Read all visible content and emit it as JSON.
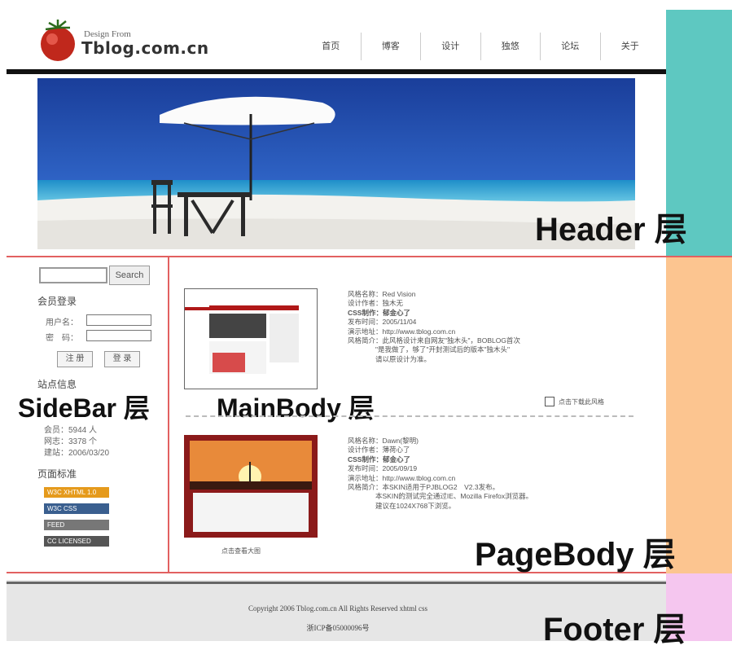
{
  "colors": {
    "header_strip": "#5ec8c1",
    "pagebody_strip": "#fcc590",
    "footer_strip": "#f5c6ef",
    "divider": "#e26060"
  },
  "logo": {
    "small_text": "Design From",
    "name": "Tblog.com.cn"
  },
  "nav": [
    "首页",
    "博客",
    "设计",
    "独悠",
    "论坛",
    "关于"
  ],
  "layers": {
    "header": "Header 层",
    "sidebar": "SideBar 层",
    "mainbody": "MainBody 层",
    "pagebody": "PageBody 层",
    "footer": "Footer 层"
  },
  "sidebar": {
    "search_button": "Search",
    "member_title": "会员登录",
    "username_label": "用户名：",
    "password_label": "密　码：",
    "register_button": "注 册",
    "login_button": "登 录",
    "site_info_title": "站点信息",
    "stats": [
      "会员：5944 人",
      "网志：3378 个",
      "建站：2006/03/20"
    ],
    "standards_title": "页面标准",
    "badges": [
      {
        "text": "W3C XHTML 1.0",
        "color": "#e59a1c"
      },
      {
        "text": "W3C CSS",
        "color": "#3a5f8f"
      },
      {
        "text": "FEED",
        "color": "#777777"
      },
      {
        "text": "CC LICENSED",
        "color": "#555555"
      }
    ]
  },
  "entries": [
    {
      "lines": [
        "风格名称：Red Vision",
        "设计作者：独木无",
        "CSS制作：郁金心了",
        "发布时间：2005/11/04",
        "演示地址：http://www.tblog.com.cn",
        "风格简介：此风格设计来自网友\"独木头\"，BOBLOG首次",
        "　　　　\"是我做了，够了\"开封测试后的版本\"独木头\"",
        "　　　　请以原设计为准。"
      ],
      "download": "点击下载此风格"
    },
    {
      "lines": [
        "风格名称：Dawn(黎明)",
        "设计作者：薄荷心了",
        "CSS制作：郁金心了",
        "发布时间：2005/09/19",
        "演示地址：http://www.tblog.com.cn",
        "风格简介：本SKIN适用于PJBLOG2　V2.3发布。",
        "　　　　本SKIN的测试完全通过IE、Mozilla Firefox浏览器。",
        "　　　　建议在1024X768下浏览。"
      ],
      "caption": "点击查看大图"
    }
  ],
  "footer": {
    "line1": "Copyright 2006 Tblog.com.cn All Rights Reserved xhtml  css",
    "line2": "浙ICP备05000096号"
  }
}
